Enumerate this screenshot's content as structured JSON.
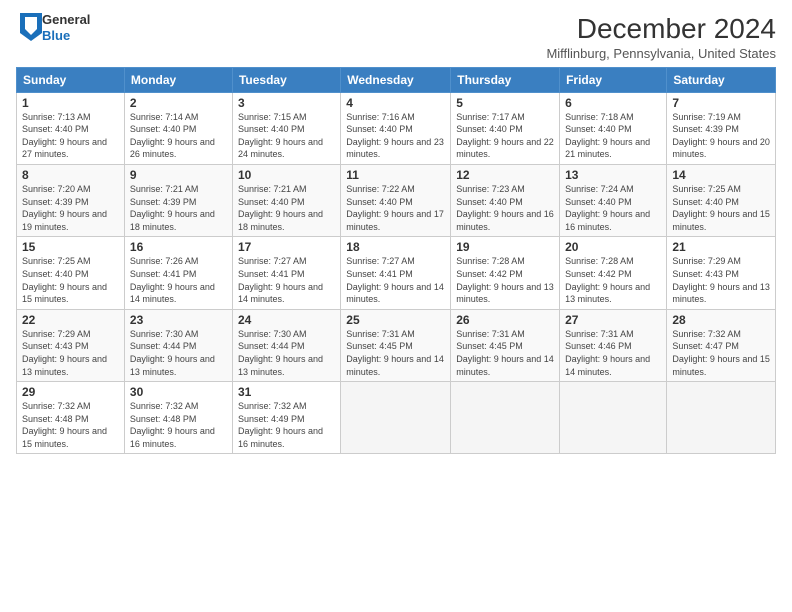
{
  "logo": {
    "line1": "General",
    "line2": "Blue"
  },
  "title": "December 2024",
  "subtitle": "Mifflinburg, Pennsylvania, United States",
  "days_of_week": [
    "Sunday",
    "Monday",
    "Tuesday",
    "Wednesday",
    "Thursday",
    "Friday",
    "Saturday"
  ],
  "weeks": [
    [
      {
        "day": "1",
        "sunrise": "7:13 AM",
        "sunset": "4:40 PM",
        "daylight_h": "9",
        "daylight_m": "27"
      },
      {
        "day": "2",
        "sunrise": "7:14 AM",
        "sunset": "4:40 PM",
        "daylight_h": "9",
        "daylight_m": "26"
      },
      {
        "day": "3",
        "sunrise": "7:15 AM",
        "sunset": "4:40 PM",
        "daylight_h": "9",
        "daylight_m": "24"
      },
      {
        "day": "4",
        "sunrise": "7:16 AM",
        "sunset": "4:40 PM",
        "daylight_h": "9",
        "daylight_m": "23"
      },
      {
        "day": "5",
        "sunrise": "7:17 AM",
        "sunset": "4:40 PM",
        "daylight_h": "9",
        "daylight_m": "22"
      },
      {
        "day": "6",
        "sunrise": "7:18 AM",
        "sunset": "4:40 PM",
        "daylight_h": "9",
        "daylight_m": "21"
      },
      {
        "day": "7",
        "sunrise": "7:19 AM",
        "sunset": "4:39 PM",
        "daylight_h": "9",
        "daylight_m": "20"
      }
    ],
    [
      {
        "day": "8",
        "sunrise": "7:20 AM",
        "sunset": "4:39 PM",
        "daylight_h": "9",
        "daylight_m": "19"
      },
      {
        "day": "9",
        "sunrise": "7:21 AM",
        "sunset": "4:39 PM",
        "daylight_h": "9",
        "daylight_m": "18"
      },
      {
        "day": "10",
        "sunrise": "7:21 AM",
        "sunset": "4:40 PM",
        "daylight_h": "9",
        "daylight_m": "18"
      },
      {
        "day": "11",
        "sunrise": "7:22 AM",
        "sunset": "4:40 PM",
        "daylight_h": "9",
        "daylight_m": "17"
      },
      {
        "day": "12",
        "sunrise": "7:23 AM",
        "sunset": "4:40 PM",
        "daylight_h": "9",
        "daylight_m": "16"
      },
      {
        "day": "13",
        "sunrise": "7:24 AM",
        "sunset": "4:40 PM",
        "daylight_h": "9",
        "daylight_m": "16"
      },
      {
        "day": "14",
        "sunrise": "7:25 AM",
        "sunset": "4:40 PM",
        "daylight_h": "9",
        "daylight_m": "15"
      }
    ],
    [
      {
        "day": "15",
        "sunrise": "7:25 AM",
        "sunset": "4:40 PM",
        "daylight_h": "9",
        "daylight_m": "15"
      },
      {
        "day": "16",
        "sunrise": "7:26 AM",
        "sunset": "4:41 PM",
        "daylight_h": "9",
        "daylight_m": "14"
      },
      {
        "day": "17",
        "sunrise": "7:27 AM",
        "sunset": "4:41 PM",
        "daylight_h": "9",
        "daylight_m": "14"
      },
      {
        "day": "18",
        "sunrise": "7:27 AM",
        "sunset": "4:41 PM",
        "daylight_h": "9",
        "daylight_m": "14"
      },
      {
        "day": "19",
        "sunrise": "7:28 AM",
        "sunset": "4:42 PM",
        "daylight_h": "9",
        "daylight_m": "13"
      },
      {
        "day": "20",
        "sunrise": "7:28 AM",
        "sunset": "4:42 PM",
        "daylight_h": "9",
        "daylight_m": "13"
      },
      {
        "day": "21",
        "sunrise": "7:29 AM",
        "sunset": "4:43 PM",
        "daylight_h": "9",
        "daylight_m": "13"
      }
    ],
    [
      {
        "day": "22",
        "sunrise": "7:29 AM",
        "sunset": "4:43 PM",
        "daylight_h": "9",
        "daylight_m": "13"
      },
      {
        "day": "23",
        "sunrise": "7:30 AM",
        "sunset": "4:44 PM",
        "daylight_h": "9",
        "daylight_m": "13"
      },
      {
        "day": "24",
        "sunrise": "7:30 AM",
        "sunset": "4:44 PM",
        "daylight_h": "9",
        "daylight_m": "13"
      },
      {
        "day": "25",
        "sunrise": "7:31 AM",
        "sunset": "4:45 PM",
        "daylight_h": "9",
        "daylight_m": "14"
      },
      {
        "day": "26",
        "sunrise": "7:31 AM",
        "sunset": "4:45 PM",
        "daylight_h": "9",
        "daylight_m": "14"
      },
      {
        "day": "27",
        "sunrise": "7:31 AM",
        "sunset": "4:46 PM",
        "daylight_h": "9",
        "daylight_m": "14"
      },
      {
        "day": "28",
        "sunrise": "7:32 AM",
        "sunset": "4:47 PM",
        "daylight_h": "9",
        "daylight_m": "15"
      }
    ],
    [
      {
        "day": "29",
        "sunrise": "7:32 AM",
        "sunset": "4:48 PM",
        "daylight_h": "9",
        "daylight_m": "15"
      },
      {
        "day": "30",
        "sunrise": "7:32 AM",
        "sunset": "4:48 PM",
        "daylight_h": "9",
        "daylight_m": "16"
      },
      {
        "day": "31",
        "sunrise": "7:32 AM",
        "sunset": "4:49 PM",
        "daylight_h": "9",
        "daylight_m": "16"
      },
      null,
      null,
      null,
      null
    ]
  ],
  "labels": {
    "sunrise": "Sunrise:",
    "sunset": "Sunset:",
    "daylight": "Daylight: {h} hours and {m} minutes."
  }
}
